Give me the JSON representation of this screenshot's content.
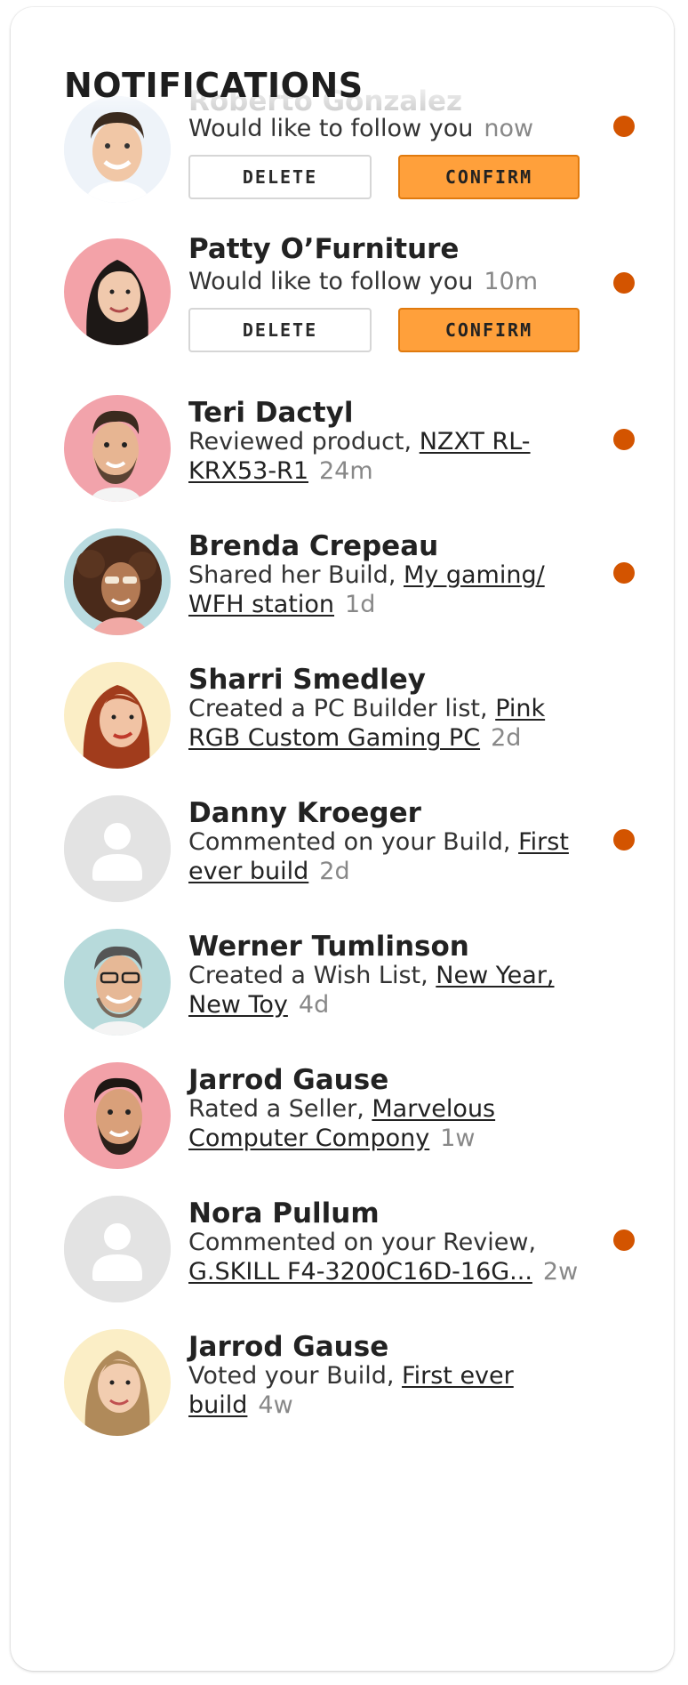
{
  "header": {
    "title": "NOTIFICATIONS"
  },
  "colors": {
    "accent": "#ffa03b",
    "unread_dot": "#d35400",
    "link": "#222222"
  },
  "buttons": {
    "delete_label": "DELETE",
    "confirm_label": "CONFIRM"
  },
  "notifications": [
    {
      "name": "Roberto Gonzalez",
      "text": "Would like to follow you",
      "link": "",
      "time": "now",
      "unread": true,
      "actions": true,
      "avatar": "photo-man-smiling"
    },
    {
      "name": "Patty O’Furniture",
      "text": "Would like to follow you",
      "link": "",
      "time": "10m",
      "unread": true,
      "actions": true,
      "avatar": "photo-woman-dark-hair"
    },
    {
      "name": "Teri Dactyl",
      "text": "Reviewed product, ",
      "link": "NZXT RL-KRX53-R1",
      "time": "24m",
      "unread": true,
      "actions": false,
      "avatar": "photo-man-beard"
    },
    {
      "name": "Brenda Crepeau",
      "text": "Shared her Build, ",
      "link": "My gaming/ WFH station",
      "time": "1d",
      "unread": true,
      "actions": false,
      "avatar": "photo-woman-curly-hair"
    },
    {
      "name": "Sharri Smedley",
      "text": "Created a PC Builder list, ",
      "link": "Pink RGB Custom Gaming PC",
      "time": "2d",
      "unread": false,
      "actions": false,
      "avatar": "photo-woman-red-hair"
    },
    {
      "name": "Danny Kroeger",
      "text": "Commented on your Build, ",
      "link": "First ever build",
      "time": "2d",
      "unread": true,
      "actions": false,
      "avatar": "default-avatar"
    },
    {
      "name": "Werner Tumlinson",
      "text": "Created a Wish List, ",
      "link": "New Year, New Toy",
      "time": "4d",
      "unread": false,
      "actions": false,
      "avatar": "photo-man-glasses"
    },
    {
      "name": "Jarrod Gause",
      "text": "Rated a Seller, ",
      "link": "Marvelous Computer Compony",
      "time": "1w",
      "unread": false,
      "actions": false,
      "avatar": "photo-man-dark-beard"
    },
    {
      "name": "Nora Pullum",
      "text": "Commented on your Review, ",
      "link": "G.SKILL F4-3200C16D-16G...",
      "time": "2w",
      "unread": true,
      "actions": false,
      "avatar": "default-avatar"
    },
    {
      "name": "Jarrod Gause",
      "text": "Voted your Build, ",
      "link": "First ever build",
      "time": "4w",
      "unread": false,
      "actions": false,
      "avatar": "photo-woman-blonde"
    }
  ]
}
